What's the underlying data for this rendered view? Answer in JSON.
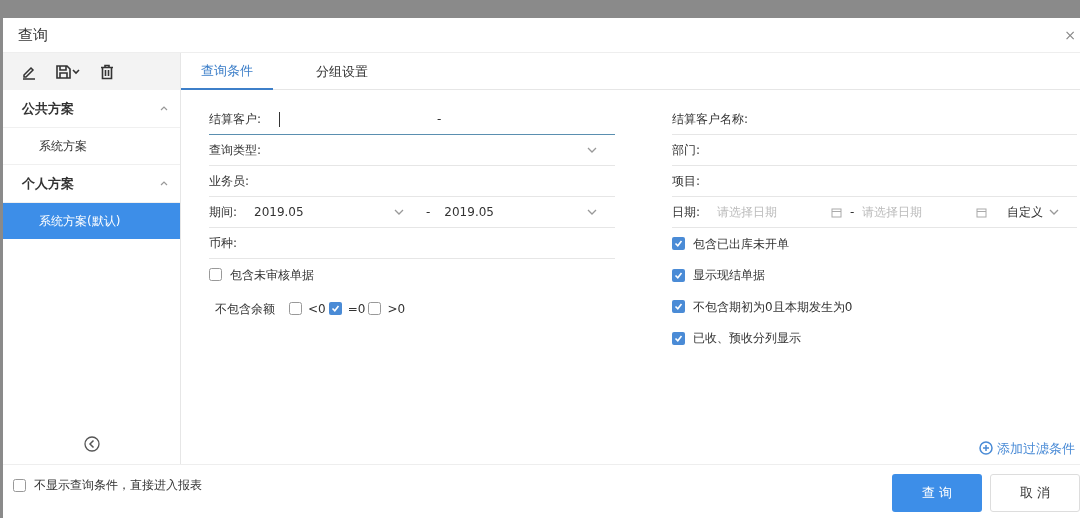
{
  "window": {
    "title": "查询",
    "close": "×"
  },
  "sidebar": {
    "groups": [
      {
        "label": "公共方案",
        "expanded": true,
        "items": [
          {
            "label": "系统方案",
            "selected": false
          }
        ]
      },
      {
        "label": "个人方案",
        "expanded": true,
        "items": [
          {
            "label": "系统方案(默认)",
            "selected": true
          }
        ]
      }
    ]
  },
  "tabs": [
    {
      "label": "查询条件",
      "selected": true
    },
    {
      "label": "分组设置",
      "selected": false
    }
  ],
  "left_fields": [
    {
      "kind": "text",
      "label": "结算客户:",
      "separator": "-",
      "focused": true
    },
    {
      "kind": "select",
      "label": "查询类型:",
      "focused": false
    },
    {
      "kind": "text",
      "label": "业务员:",
      "focused": false
    },
    {
      "kind": "period",
      "label": "期间:",
      "from": "2019.05",
      "separator": "-",
      "to": "2019.05",
      "focused": false
    },
    {
      "kind": "text",
      "label": "币种:",
      "focused": false
    }
  ],
  "left_checks": [
    {
      "label": "包含未审核单据",
      "checked": false
    }
  ],
  "balance": {
    "label": "不包含余额",
    "options": [
      {
        "label": "<0",
        "checked": false
      },
      {
        "label": "=0",
        "checked": true
      },
      {
        "label": ">0",
        "checked": false
      }
    ]
  },
  "right_fields": [
    {
      "kind": "text",
      "label": "结算客户名称:"
    },
    {
      "kind": "text",
      "label": "部门:"
    },
    {
      "kind": "text",
      "label": "项目:"
    },
    {
      "kind": "date",
      "label": "日期:",
      "placeholder_from": "请选择日期",
      "separator": "-",
      "placeholder_to": "请选择日期",
      "mode": "自定义"
    }
  ],
  "right_checks": [
    {
      "label": "包含已出库未开单",
      "checked": true
    },
    {
      "label": "显示现结单据",
      "checked": true
    },
    {
      "label": "不包含期初为0且本期发生为0",
      "checked": true
    },
    {
      "label": "已收、预收分列显示",
      "checked": true
    }
  ],
  "add_filter": "添加过滤条件",
  "footer": {
    "checkbox": {
      "label": "不显示查询条件，直接进入报表",
      "checked": false
    },
    "buttons": [
      {
        "label": "查 询",
        "kind": "primary"
      },
      {
        "label": "取 消",
        "kind": "default"
      }
    ]
  }
}
